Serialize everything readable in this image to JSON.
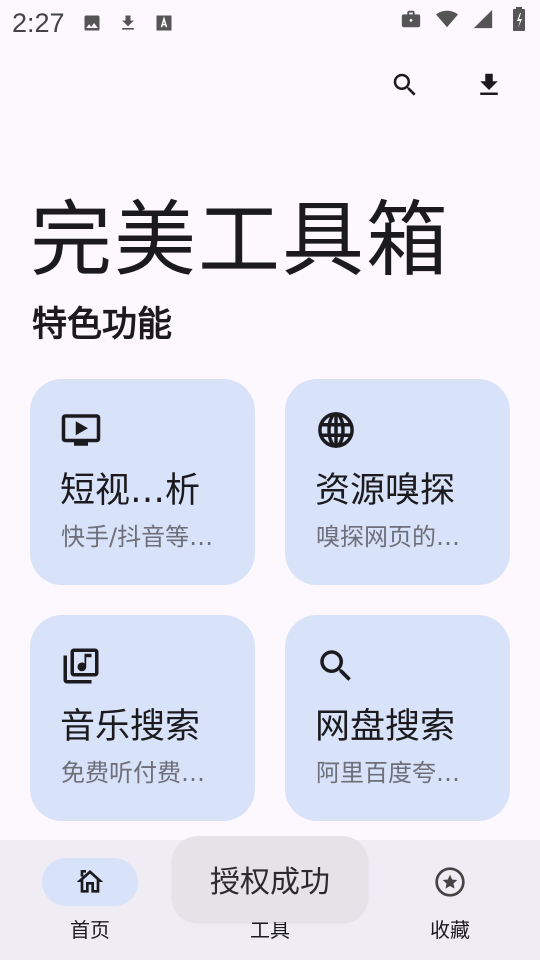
{
  "status_bar": {
    "time": "2:27",
    "left_icons": [
      "image-icon",
      "download-icon",
      "font-icon"
    ],
    "right_icons": [
      "briefcase-icon",
      "wifi-icon",
      "signal-icon",
      "battery-icon"
    ]
  },
  "toolbar": {
    "actions": [
      "search-icon",
      "download-icon"
    ]
  },
  "app_title": "完美工具箱",
  "section_title": "特色功能",
  "cards": [
    {
      "icon": "tv-play-icon",
      "title": "短视…析",
      "subtitle": "快手/抖音等…"
    },
    {
      "icon": "globe-icon",
      "title": "资源嗅探",
      "subtitle": "嗅探网页的…"
    },
    {
      "icon": "music-library-icon",
      "title": "音乐搜索",
      "subtitle": "免费听付费…"
    },
    {
      "icon": "search-icon",
      "title": "网盘搜索",
      "subtitle": "阿里百度夸…"
    }
  ],
  "bottom_nav": {
    "items": [
      {
        "icon": "home-icon",
        "label": "首页",
        "active": true
      },
      {
        "icon": "tools-icon",
        "label": "工具",
        "active": false
      },
      {
        "icon": "star-icon",
        "label": "收藏",
        "active": false
      }
    ]
  },
  "toast": "授权成功",
  "colors": {
    "background": "#fcf8fd",
    "card": "#d8e2f8",
    "nav_background": "#efecf4",
    "text": "#1b1b1f",
    "subtext": "#6d6f7a"
  }
}
